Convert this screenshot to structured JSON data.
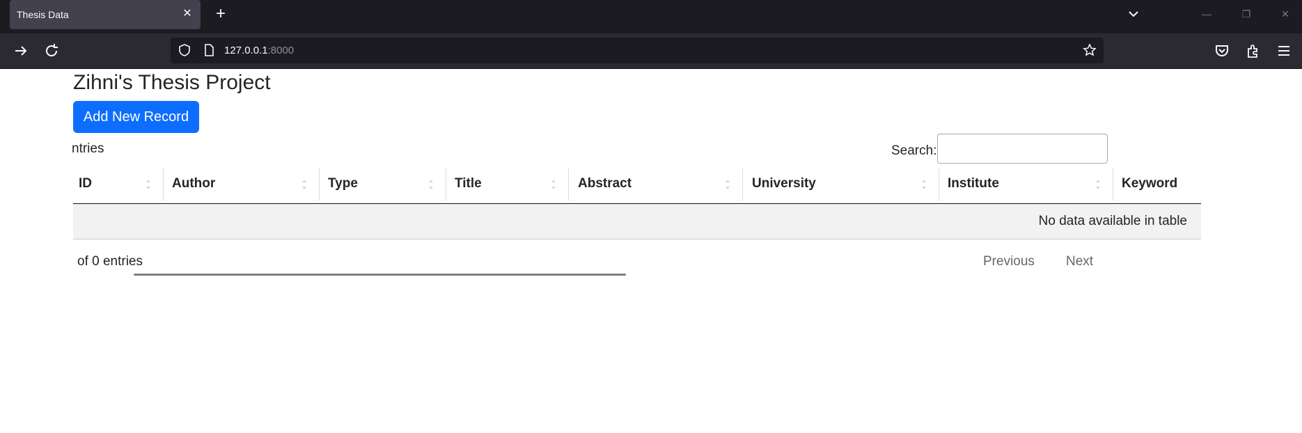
{
  "browser": {
    "tab_title": "Thesis Data",
    "url_host": "127.0.0.1",
    "url_port": ":8000",
    "icons": [
      "close-icon",
      "plus-icon",
      "chevron-down-icon",
      "minimize-icon",
      "restore-icon",
      "window-close-icon",
      "forward-icon",
      "reload-icon",
      "shield-icon",
      "page-icon",
      "bookmark-star-icon",
      "pocket-icon",
      "extensions-icon",
      "menu-icon"
    ]
  },
  "page": {
    "title": "Zihni's Thesis Project",
    "add_button": "Add New Record",
    "entries_label": "ntries",
    "search_label": "Search:",
    "search_value": ""
  },
  "table": {
    "columns": [
      "ID",
      "Author",
      "Type",
      "Title",
      "Abstract",
      "University",
      "Institute",
      "Keyword"
    ],
    "empty_message": "No data available in table"
  },
  "footer": {
    "info": "of 0 entries",
    "previous": "Previous",
    "next": "Next"
  },
  "colors": {
    "accent": "#0d6efd",
    "chrome_bg": "#1c1b22",
    "nav_bg": "#2b2a33"
  }
}
